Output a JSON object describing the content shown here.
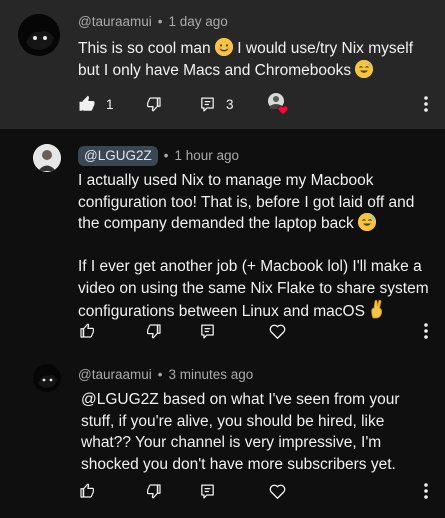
{
  "comments": [
    {
      "handle": "@tauraamui",
      "time": "1 day ago",
      "text": "This is so cool man 😊 I would use/try Nix myself but I only have Macs and Chromebooks 😅",
      "line1": "This is so cool man",
      "line1b": "I would use/try Nix myself",
      "line2": "but I only have Macs and Chromebooks",
      "likes": "1",
      "replies": "3",
      "liked": true,
      "creator_heart": true
    },
    {
      "handle": "@LGUG2Z",
      "time": "1 hour ago",
      "is_creator": true,
      "p1_l1": "I actually used Nix to manage my Macbook",
      "p1_l2": "configuration too! That is, before I got laid off and",
      "p1_l3": "the company demanded the laptop back",
      "p2_l1": "If I ever get another job (+ Macbook lol) I'll make a",
      "p2_l2": "video on using the same Nix Flake to share system",
      "p2_l3": "configurations between Linux and macOS"
    },
    {
      "handle": "@tauraamui",
      "time": "3 minutes ago",
      "l1": "@LGUG2Z based on what I've seen from your",
      "l2": "stuff, if you're alive, you should be hired, like",
      "l3": "what?? Your channel is very impressive, I'm",
      "l4": "shocked you don't have more subscribers yet."
    }
  ],
  "icons": [
    "thumb-up-icon",
    "thumb-down-icon",
    "reply-icon",
    "heart-icon",
    "more-vert-icon",
    "creator-heart-icon"
  ],
  "colors": {
    "background": "#0f0f0f",
    "highlight": "#272727",
    "chip": "#3a4652",
    "heart": "#ff0033",
    "meta": "#aaaaaa"
  }
}
